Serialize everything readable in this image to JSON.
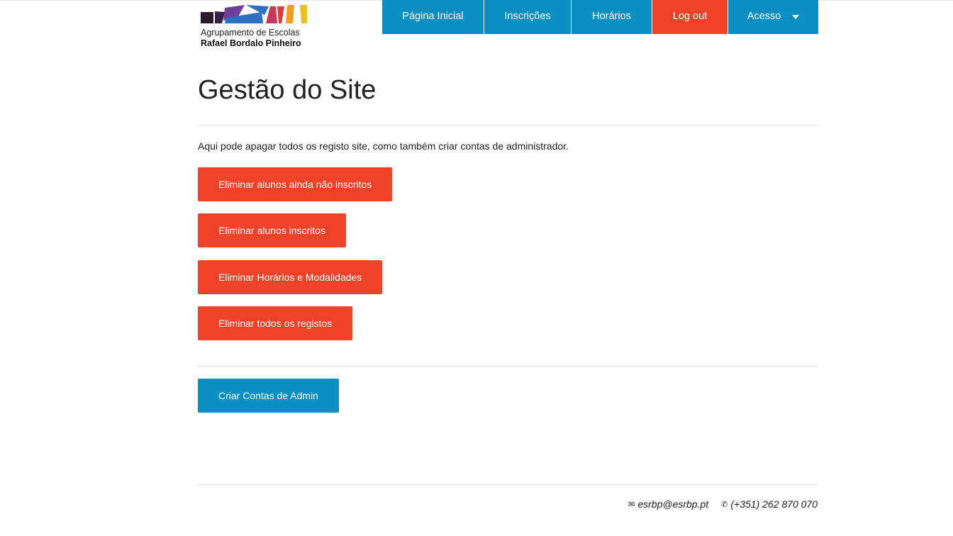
{
  "brand": {
    "line1": "Agrupamento de Escolas",
    "line2": "Rafael Bordalo Pinheiro",
    "logo_colors": [
      "#3a1f2e",
      "#6f3f9a",
      "#2e6fc0",
      "#c43a58",
      "#f0a020",
      "#e8c020",
      "#f04228"
    ]
  },
  "nav": {
    "items": [
      {
        "label": "Página Inicial"
      },
      {
        "label": "Inscrições"
      },
      {
        "label": "Horários"
      },
      {
        "label": "Log out"
      },
      {
        "label": "Acesso",
        "icon": "caret-down-icon"
      }
    ]
  },
  "main": {
    "title": "Gestão do Site",
    "intro": "Aqui pode apagar todos os registo site, como também criar contas de administrador.",
    "buttons": [
      {
        "label": "Eliminar alunos ainda não inscritos"
      },
      {
        "label": "Eliminar alunos inscritos"
      },
      {
        "label": "Eliminar Horários e Modalidades"
      },
      {
        "label": "Eliminar todos os registos"
      }
    ],
    "admin_button": "Criar Contas de Admin"
  },
  "footer": {
    "email_icon": "envelope-icon",
    "email": "esrbp@esrbp.pt",
    "phone_icon": "phone-icon",
    "phone": "(+351) 262 870 070"
  },
  "colors": {
    "accent_blue": "#0a8fc2",
    "accent_red": "#f04228"
  }
}
